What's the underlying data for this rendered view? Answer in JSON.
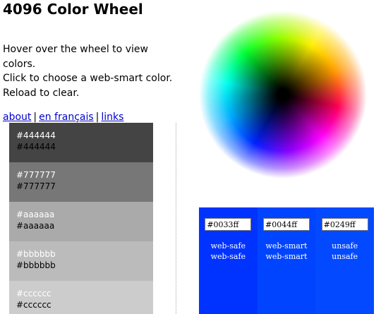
{
  "page": {
    "title": "4096 Color Wheel",
    "intro": [
      "Hover over the wheel to view colors.",
      "Click to choose a web-smart color.",
      "Reload to clear."
    ]
  },
  "nav": {
    "links": [
      {
        "label": "about"
      },
      {
        "label": "en français"
      },
      {
        "label": "links"
      }
    ],
    "separator": "|"
  },
  "swatches": [
    {
      "top": "#444444",
      "bottom": "#444444",
      "bg": "#444444",
      "top_color": "#ffffff"
    },
    {
      "top": "#777777",
      "bottom": "#777777",
      "bg": "#777777",
      "top_color": "#ffffff"
    },
    {
      "top": "#aaaaaa",
      "bottom": "#aaaaaa",
      "bg": "#aaaaaa",
      "top_color": "#ffffff"
    },
    {
      "top": "#bbbbbb",
      "bottom": "#bbbbbb",
      "bg": "#bbbbbb",
      "top_color": "#ffffff"
    },
    {
      "top": "#cccccc",
      "bottom": "#cccccc",
      "bg": "#cccccc",
      "top_color": "#ffffff"
    }
  ],
  "panel": {
    "bg": "#0033ff",
    "columns": [
      {
        "hex": "#0033ff",
        "label1": "web-safe",
        "label2": "web-safe",
        "bg": "#0033ff"
      },
      {
        "hex": "#0044ff",
        "label1": "web-smart",
        "label2": "web-smart",
        "bg": "#0044ff"
      },
      {
        "hex": "#0249ff",
        "label1": "unsafe",
        "label2": "unsafe",
        "bg": "#0249ff"
      }
    ]
  }
}
